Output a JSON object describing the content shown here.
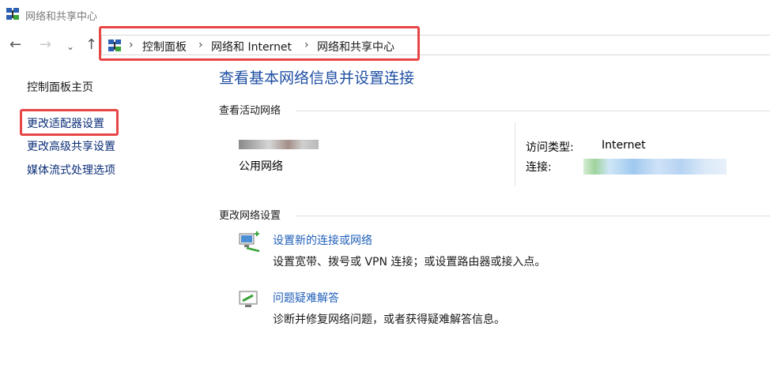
{
  "window": {
    "title": "网络和共享中心"
  },
  "nav": {
    "back_icon": "←",
    "forward_icon": "→",
    "recent_icon": "⌄",
    "up_icon": "↑",
    "breadcrumbs": [
      "控制面板",
      "网络和 Internet",
      "网络和共享中心"
    ],
    "separator": "›"
  },
  "left_pane": {
    "home": "控制面板主页",
    "adapter": "更改适配器设置",
    "advanced_sharing": "更改高级共享设置",
    "media_streaming": "媒体流式处理选项"
  },
  "main": {
    "title": "查看基本网络信息并设置连接",
    "active_networks_header": "查看活动网络",
    "network_type": "公用网络",
    "access_type_label": "访问类型:",
    "access_type_value": "Internet",
    "connection_label": "连接:",
    "change_settings_header": "更改网络设置",
    "items": [
      {
        "icon": "new-connection-icon",
        "link": "设置新的连接或网络",
        "desc": "设置宽带、拨号或 VPN 连接；或设置路由器或接入点。"
      },
      {
        "icon": "troubleshoot-icon",
        "link": "问题疑难解答",
        "desc": "诊断并修复网络问题，或者获得疑难解答信息。"
      }
    ]
  },
  "colors": {
    "highlight": "#e84545",
    "link": "#1f5fb8",
    "title": "#1f4fa3"
  }
}
